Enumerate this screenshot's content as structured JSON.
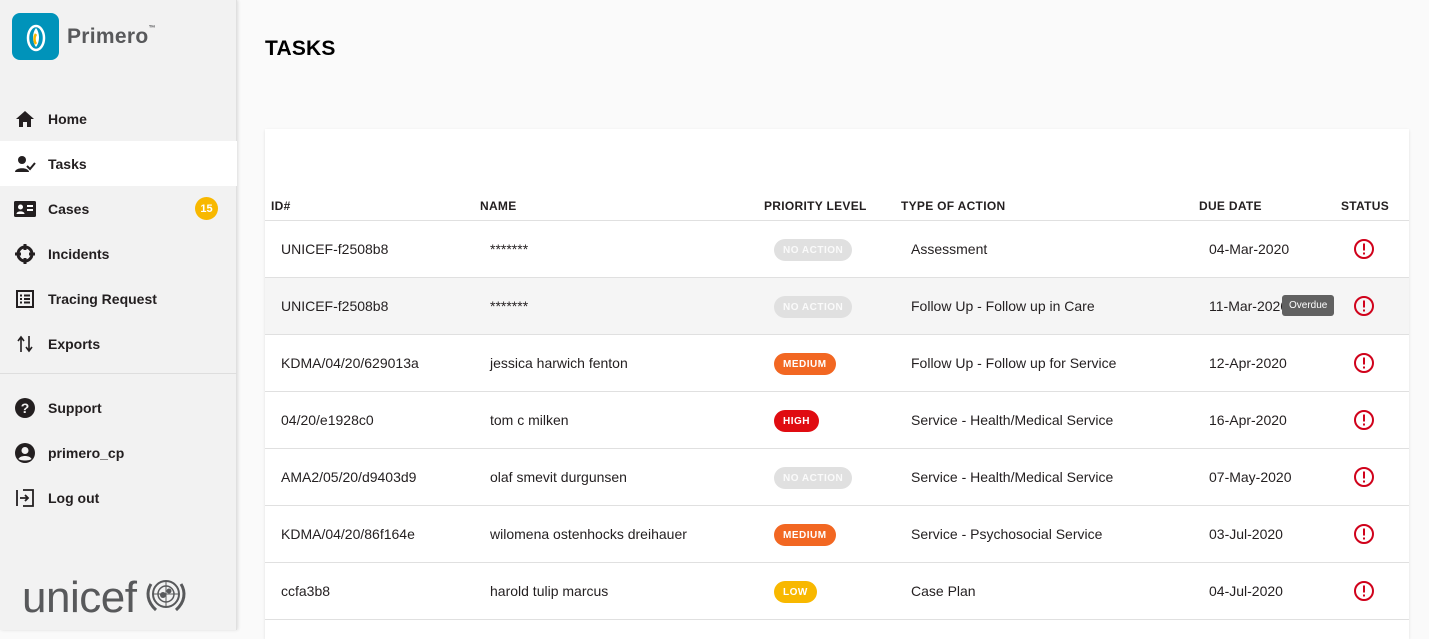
{
  "app": {
    "name": "Primero",
    "tm": "™"
  },
  "sidebar": {
    "items": [
      {
        "label": "Home",
        "icon": "home-icon"
      },
      {
        "label": "Tasks",
        "icon": "tasks-icon",
        "active": true
      },
      {
        "label": "Cases",
        "icon": "cases-icon",
        "badge": "15"
      },
      {
        "label": "Incidents",
        "icon": "incidents-icon"
      },
      {
        "label": "Tracing Request",
        "icon": "list-icon"
      },
      {
        "label": "Exports",
        "icon": "sort-arrows-icon"
      },
      {
        "label": "Support",
        "icon": "help-icon"
      },
      {
        "label": "primero_cp",
        "icon": "account-icon"
      },
      {
        "label": "Log out",
        "icon": "logout-icon"
      }
    ],
    "footer_logo": "unicef"
  },
  "page": {
    "title": "TASKS"
  },
  "table": {
    "columns": [
      "ID#",
      "NAME",
      "PRIORITY LEVEL",
      "TYPE OF ACTION",
      "DUE DATE",
      "STATUS"
    ],
    "rows": [
      {
        "id": "UNICEF-f2508b8",
        "name": "*******",
        "priority": "NO ACTION",
        "action": "Assessment",
        "due": "04-Mar-2020"
      },
      {
        "id": "UNICEF-f2508b8",
        "name": "*******",
        "priority": "NO ACTION",
        "action": "Follow Up - Follow up in Care",
        "due": "11-Mar-2020"
      },
      {
        "id": "KDMA/04/20/629013a",
        "name": "jessica harwich fenton",
        "priority": "MEDIUM",
        "action": "Follow Up - Follow up for Service",
        "due": "12-Apr-2020"
      },
      {
        "id": "04/20/e1928c0",
        "name": "tom c milken",
        "priority": "HIGH",
        "action": "Service - Health/Medical Service",
        "due": "16-Apr-2020"
      },
      {
        "id": "AMA2/05/20/d9403d9",
        "name": "olaf smevit durgunsen",
        "priority": "NO ACTION",
        "action": "Service - Health/Medical Service",
        "due": "07-May-2020"
      },
      {
        "id": "KDMA/04/20/86f164e",
        "name": "wilomena ostenhocks dreihauer",
        "priority": "MEDIUM",
        "action": "Service - Psychosocial Service",
        "due": "03-Jul-2020"
      },
      {
        "id": "ccfa3b8",
        "name": "harold tulip marcus",
        "priority": "LOW",
        "action": "Case Plan",
        "due": "04-Jul-2020"
      }
    ],
    "status_icon": "alert-circle-icon",
    "tooltip": "Overdue"
  },
  "colors": {
    "no_action": "#e0e0e0",
    "medium": "#f26722",
    "high": "#e00c11",
    "low": "#f8b800",
    "status_alert": "#d0021b"
  }
}
